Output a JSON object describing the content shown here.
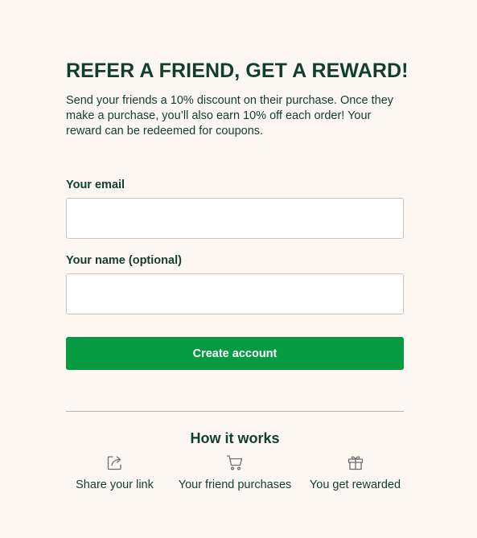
{
  "referral": {
    "title": "REFER A FRIEND, GET A REWARD!",
    "description": "Send your friends a 10% discount on their purchase. Once they make a purchase, you’ll also earn 10% off each order! Your reward can be redeemed for coupons."
  },
  "form": {
    "email_label": "Your email",
    "email_value": "",
    "email_placeholder": "",
    "name_label": "Your name (optional)",
    "name_value": "",
    "name_placeholder": "",
    "submit_label": "Create account"
  },
  "how_it_works": {
    "title": "How it works",
    "steps": [
      {
        "icon": "share-icon",
        "label": "Share your link"
      },
      {
        "icon": "cart-icon",
        "label": "Your friend purchases"
      },
      {
        "icon": "gift-icon",
        "label": "You get rewarded"
      }
    ]
  },
  "colors": {
    "background": "#fdf7f1",
    "text": "#123f2a",
    "button": "#069a41",
    "button_text": "#ffffff",
    "input_border": "#c8c3bf",
    "divider": "#b9b6b2"
  }
}
